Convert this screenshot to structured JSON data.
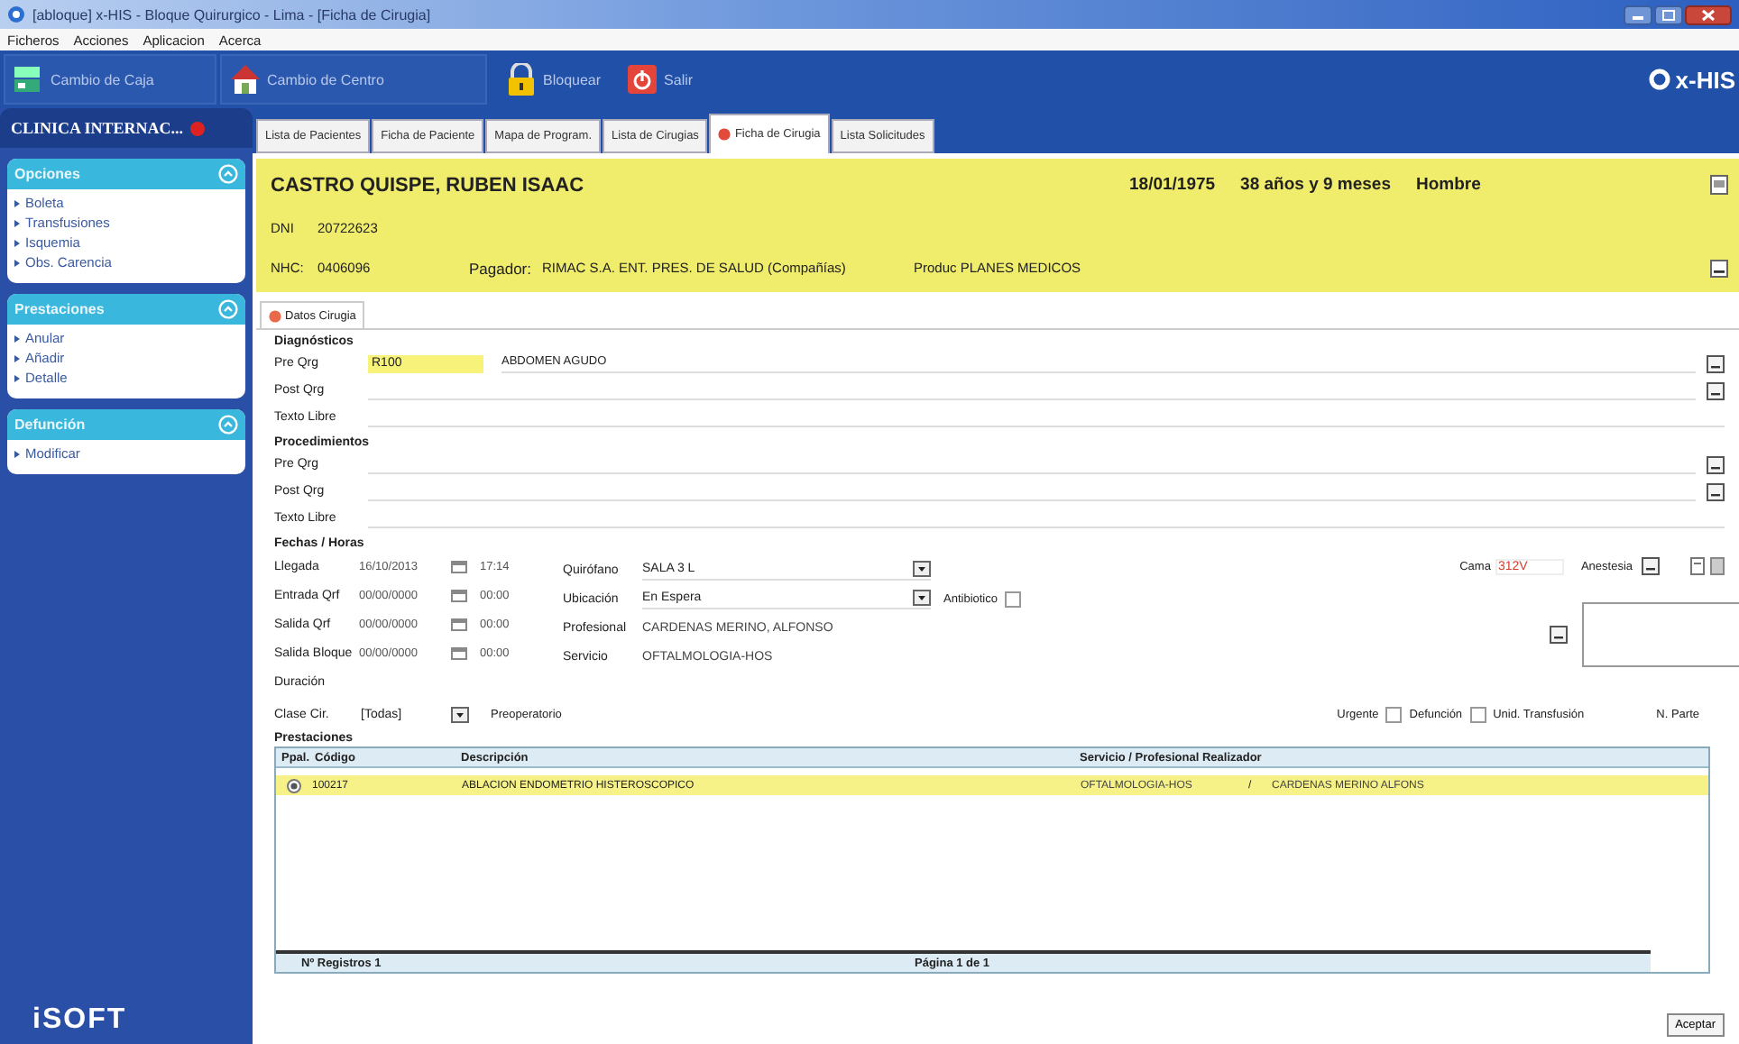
{
  "window": {
    "title": "[abloque] x-HIS - Bloque Quirurgico - Lima - [Ficha de Cirugia]"
  },
  "menu": [
    "Ficheros",
    "Acciones",
    "Aplicacion",
    "Acerca"
  ],
  "toolbar": [
    {
      "label": "Cambio de Caja",
      "kind": "cash"
    },
    {
      "label": "Cambio de Centro",
      "kind": "house"
    },
    {
      "label": "Bloquear",
      "kind": "lock"
    },
    {
      "label": "Salir",
      "kind": "exit"
    }
  ],
  "brand": "x-HIS",
  "sidebar": {
    "center": "CLINICA INTERNAC...",
    "panels": [
      {
        "title": "Opciones",
        "expanded": true,
        "items": [
          "Boleta",
          "Transfusiones",
          "Isquemia",
          "Obs. Carencia"
        ]
      },
      {
        "title": "Prestaciones",
        "expanded": true,
        "items": [
          "Anular",
          "Añadir",
          "Detalle"
        ]
      },
      {
        "title": "Defunción",
        "expanded": true,
        "items": [
          "Modificar"
        ]
      }
    ],
    "logo": "iSOFT"
  },
  "tabs": [
    {
      "label": "Lista de Pacientes",
      "selected": false,
      "alert": false
    },
    {
      "label": "Ficha de Paciente",
      "selected": false,
      "alert": false
    },
    {
      "label": "Mapa de Program.",
      "selected": false,
      "alert": false
    },
    {
      "label": "Lista de Cirugias",
      "selected": false,
      "alert": false
    },
    {
      "label": "Ficha de Cirugia",
      "selected": true,
      "alert": true
    },
    {
      "label": "Lista Solicitudes",
      "selected": false,
      "alert": false
    }
  ],
  "patient": {
    "name": "CASTRO QUISPE, RUBEN ISAAC",
    "birth": "18/01/1975",
    "age": "38 años y 9 meses",
    "sex": "Hombre",
    "dni_label": "DNI",
    "dni": "20722623",
    "nhc_label": "NHC:",
    "nhc": "0406096",
    "payer_label": "Pagador:",
    "payer": "RIMAC S.A. ENT. PRES. DE SALUD (Compañías)",
    "product": "Produc PLANES MEDICOS"
  },
  "subtabs": [
    {
      "label": "Datos Cirugia",
      "selected": true
    }
  ],
  "diagnosticos": {
    "title": "Diagnósticos",
    "rows": [
      {
        "label": "Pre Qrg",
        "code": "R100",
        "description": "ABDOMEN AGUDO",
        "lookup": true
      },
      {
        "label": "Post Qrg",
        "lookup": true
      },
      {
        "label": "Texto Libre",
        "lookup": false
      }
    ]
  },
  "procedimientos": {
    "title": "Procedimientos",
    "rows": [
      {
        "label": "Pre Qrg",
        "lookup": true
      },
      {
        "label": "Post Qrg",
        "lookup": true
      },
      {
        "label": "Texto Libre",
        "lookup": false
      }
    ]
  },
  "fechas": {
    "title": "Fechas / Horas",
    "rows": [
      {
        "label": "Llegada",
        "date": "16/10/2013",
        "time": "17:14"
      },
      {
        "label": "Entrada Qrf",
        "date": "00/00/0000",
        "time": "00:00"
      },
      {
        "label": "Salida Qrf",
        "date": "00/00/0000",
        "time": "00:00"
      },
      {
        "label": "Salida Bloque",
        "date": "00/00/0000",
        "time": "00:00"
      },
      {
        "label": "Duración"
      }
    ]
  },
  "details": [
    {
      "label": "Quirófano",
      "value": "SALA 3 L",
      "kind": "select"
    },
    {
      "label": "Ubicación",
      "value": "En Espera",
      "kind": "select"
    },
    {
      "label": "Profesional",
      "value": "CARDENAS MERINO, ALFONSO",
      "kind": "text"
    },
    {
      "label": "Servicio",
      "value": "OFTALMOLOGIA-HOS",
      "kind": "text"
    }
  ],
  "antibiotico": {
    "label": "Antibiotico",
    "checked": false
  },
  "cama": {
    "label": "Cama",
    "value": "312V"
  },
  "anestesia": {
    "label": "Anestesia"
  },
  "clase": {
    "label": "Clase Cir.",
    "value": "[Todas]"
  },
  "preoperatorio": "Preoperatorio",
  "flags": [
    {
      "label": "Urgente",
      "checked": false
    },
    {
      "label": "Defunción",
      "checked": false
    }
  ],
  "transfusion": "Unid. Transfusión",
  "parte": "N. Parte",
  "prestaciones": {
    "title": "Prestaciones",
    "columns": [
      "Ppal.",
      "Código",
      "Descripción",
      "Servicio / Profesional Realizador"
    ],
    "rows": [
      {
        "principal": true,
        "code": "100217",
        "description": "ABLACION ENDOMETRIO HISTEROSCOPICO",
        "service": "OFTALMOLOGIA-HOS",
        "separator": "/",
        "professional": "CARDENAS MERINO ALFONS",
        "selected": true
      }
    ],
    "count": "Nº Registros 1",
    "page": "Página 1 de 1"
  },
  "accept": "Aceptar"
}
